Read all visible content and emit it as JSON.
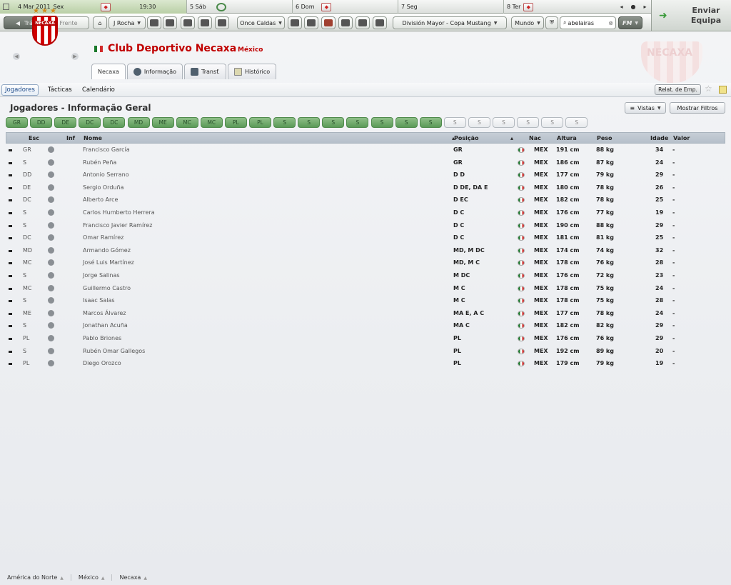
{
  "topbar": {
    "days": [
      {
        "date": "4 Mar 2011",
        "dow": "Sex",
        "time": "19:30",
        "icon": "team-crest-icon"
      },
      {
        "label": "5 Sáb",
        "icon": "game-icon"
      },
      {
        "label": "6 Dom",
        "icon": "team-crest-icon"
      },
      {
        "label": "7 Seg",
        "icon": ""
      },
      {
        "label": "8 Ter",
        "icon": "team-crest-icon"
      }
    ],
    "nav_prev": "◂",
    "nav_mid": "●",
    "nav_next": "▸"
  },
  "continue": {
    "label1": "Enviar",
    "label2": "Equipa"
  },
  "toolbar": {
    "back": "Trás",
    "forward": "Frente",
    "manager": "J Rocha",
    "club_menu": "Once Caldas",
    "competition": "División Mayor - Copa Mustang",
    "world": "Mundo",
    "search_value": "abelairas",
    "fm_menu": "FM"
  },
  "club": {
    "name": "Club Deportivo Necaxa",
    "country": "México",
    "crest_text": "NECAXA"
  },
  "tabs": [
    "Necaxa",
    "Informação",
    "Transf.",
    "Histórico"
  ],
  "subnav": {
    "items": [
      "Jogadores",
      "Tácticas",
      "Calendário"
    ],
    "relat": "Relat. de Emp."
  },
  "page": {
    "title": "Jogadores - Informação Geral",
    "vistas": "Vistas",
    "filtros": "Mostrar Filtros"
  },
  "chips": [
    "GR",
    "DD",
    "DE",
    "DC",
    "DC",
    "MD",
    "ME",
    "MC",
    "MC",
    "PL",
    "PL",
    "S",
    "S",
    "S",
    "S",
    "S",
    "S",
    "S",
    "S",
    "S",
    "S",
    "S",
    "S",
    "S"
  ],
  "chips_filled": 18,
  "headers": {
    "esc": "Esc",
    "inf": "Inf",
    "nome": "Nome",
    "posicao": "Posição",
    "nac": "Nac",
    "altura": "Altura",
    "peso": "Peso",
    "idade": "Idade",
    "valor": "Valor"
  },
  "players": [
    {
      "esc": "GR",
      "nome": "Francisco García",
      "pos": "GR",
      "nac": "MEX",
      "alt": "191 cm",
      "peso": "88 kg",
      "idade": "34",
      "valor": "-"
    },
    {
      "esc": "S",
      "nome": "Rubén Peña",
      "pos": "GR",
      "nac": "MEX",
      "alt": "186 cm",
      "peso": "87 kg",
      "idade": "24",
      "valor": "-"
    },
    {
      "esc": "DD",
      "nome": "Antonio Serrano",
      "pos": "D D",
      "nac": "MEX",
      "alt": "177 cm",
      "peso": "79 kg",
      "idade": "29",
      "valor": "-"
    },
    {
      "esc": "DE",
      "nome": "Sergio Orduña",
      "pos": "D DE, DA E",
      "nac": "MEX",
      "alt": "180 cm",
      "peso": "78 kg",
      "idade": "26",
      "valor": "-"
    },
    {
      "esc": "DC",
      "nome": "Alberto Arce",
      "pos": "D EC",
      "nac": "MEX",
      "alt": "182 cm",
      "peso": "78 kg",
      "idade": "25",
      "valor": "-"
    },
    {
      "esc": "S",
      "nome": "Carlos Humberto Herrera",
      "pos": "D C",
      "nac": "MEX",
      "alt": "176 cm",
      "peso": "77 kg",
      "idade": "19",
      "valor": "-"
    },
    {
      "esc": "S",
      "nome": "Francisco Javier Ramírez",
      "pos": "D C",
      "nac": "MEX",
      "alt": "190 cm",
      "peso": "88 kg",
      "idade": "29",
      "valor": "-"
    },
    {
      "esc": "DC",
      "nome": "Omar Ramírez",
      "pos": "D C",
      "nac": "MEX",
      "alt": "181 cm",
      "peso": "81 kg",
      "idade": "25",
      "valor": "-"
    },
    {
      "esc": "MD",
      "nome": "Armando Gómez",
      "pos": "MD, M DC",
      "nac": "MEX",
      "alt": "174 cm",
      "peso": "74 kg",
      "idade": "32",
      "valor": "-"
    },
    {
      "esc": "MC",
      "nome": "José Luis Martínez",
      "pos": "MD, M C",
      "nac": "MEX",
      "alt": "178 cm",
      "peso": "76 kg",
      "idade": "28",
      "valor": "-"
    },
    {
      "esc": "S",
      "nome": "Jorge Salinas",
      "pos": "M DC",
      "nac": "MEX",
      "alt": "176 cm",
      "peso": "72 kg",
      "idade": "23",
      "valor": "-"
    },
    {
      "esc": "MC",
      "nome": "Guillermo Castro",
      "pos": "M C",
      "nac": "MEX",
      "alt": "178 cm",
      "peso": "75 kg",
      "idade": "24",
      "valor": "-"
    },
    {
      "esc": "S",
      "nome": "Isaac Salas",
      "pos": "M C",
      "nac": "MEX",
      "alt": "178 cm",
      "peso": "75 kg",
      "idade": "28",
      "valor": "-"
    },
    {
      "esc": "ME",
      "nome": "Marcos Álvarez",
      "pos": "MA E, A C",
      "nac": "MEX",
      "alt": "177 cm",
      "peso": "78 kg",
      "idade": "24",
      "valor": "-"
    },
    {
      "esc": "S",
      "nome": "Jonathan Acuña",
      "pos": "MA C",
      "nac": "MEX",
      "alt": "182 cm",
      "peso": "82 kg",
      "idade": "29",
      "valor": "-"
    },
    {
      "esc": "PL",
      "nome": "Pablo Briones",
      "pos": "PL",
      "nac": "MEX",
      "alt": "176 cm",
      "peso": "76 kg",
      "idade": "29",
      "valor": "-"
    },
    {
      "esc": "S",
      "nome": "Rubén Omar Gallegos",
      "pos": "PL",
      "nac": "MEX",
      "alt": "192 cm",
      "peso": "89 kg",
      "idade": "20",
      "valor": "-"
    },
    {
      "esc": "PL",
      "nome": "Diego Orozco",
      "pos": "PL",
      "nac": "MEX",
      "alt": "179 cm",
      "peso": "79 kg",
      "idade": "19",
      "valor": "-"
    }
  ],
  "footer": [
    "América do Norte",
    "México",
    "Necaxa"
  ],
  "colors": {
    "club_red": "#c00000",
    "chip_green": "#5b9a58",
    "header_bg": "#b6c0ca"
  }
}
